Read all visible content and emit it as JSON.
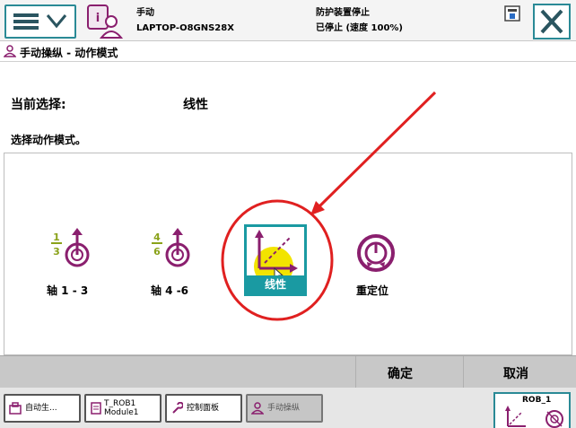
{
  "header": {
    "mode": "手动",
    "controller": "LAPTOP-O8GNS28X",
    "state": "防护装置停止",
    "speed_status": "已停止 (速度 100%)"
  },
  "title": "手动操纵 - 动作模式",
  "selection": {
    "label": "当前选择:",
    "value": "线性",
    "instruction": "选择动作模式。"
  },
  "modes": [
    {
      "id": "axis13",
      "label": "轴 1 - 3",
      "fraction": [
        "1",
        "3"
      ]
    },
    {
      "id": "axis46",
      "label": "轴 4 -6",
      "fraction": [
        "4",
        "6"
      ]
    },
    {
      "id": "linear",
      "label": "线性",
      "selected": true
    },
    {
      "id": "reorient",
      "label": "重定位"
    }
  ],
  "commands": {
    "ok": "确定",
    "cancel": "取消"
  },
  "taskbar": {
    "items": [
      {
        "label": "自动生..."
      },
      {
        "label1": "T_ROB1",
        "label2": "Module1"
      },
      {
        "label": "控制面板"
      },
      {
        "label": "手动操纵",
        "active": true
      }
    ],
    "rob": "ROB_1"
  },
  "colors": {
    "accent": "#1a9aa2",
    "annotation": "#e02020",
    "icon_purple": "#8a1f6e",
    "fraction_olive": "#8aa21a"
  }
}
